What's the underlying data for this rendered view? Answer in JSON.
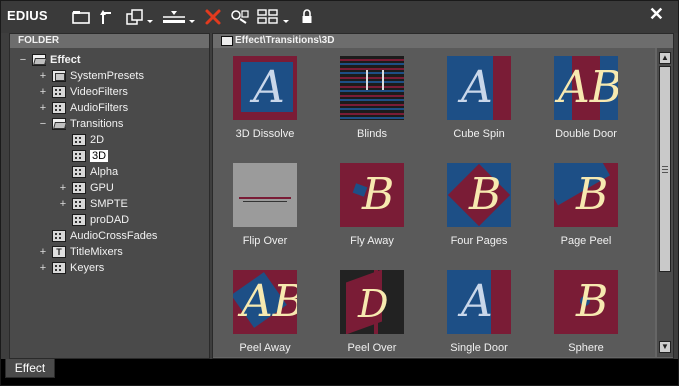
{
  "app": {
    "title": "EDIUS",
    "close_symbol": "✕"
  },
  "toolbar": {
    "icons": [
      "folder-icon",
      "up-level-icon",
      "copy-dropdown-icon",
      "insert-dropdown-icon",
      "delete-icon",
      "properties-icon",
      "view-mode-dropdown-icon",
      "lock-icon"
    ],
    "delete_color": "#e23a1e"
  },
  "left_panel": {
    "header": "FOLDER",
    "tree": [
      {
        "label": "Effect",
        "expander": "−",
        "icon": "folder-open-icon",
        "depth": 0,
        "bold": true
      },
      {
        "label": "SystemPresets",
        "expander": "+",
        "icon": "folder-icon",
        "depth": 1
      },
      {
        "label": "VideoFilters",
        "expander": "+",
        "icon": "grid-icon",
        "depth": 1
      },
      {
        "label": "AudioFilters",
        "expander": "+",
        "icon": "grid-icon",
        "depth": 1
      },
      {
        "label": "Transitions",
        "expander": "−",
        "icon": "folder-open-icon",
        "depth": 1
      },
      {
        "label": "2D",
        "expander": "",
        "icon": "grid-icon",
        "depth": 2
      },
      {
        "label": "3D",
        "expander": "",
        "icon": "grid-icon",
        "depth": 2,
        "selected": true
      },
      {
        "label": "Alpha",
        "expander": "",
        "icon": "grid-icon",
        "depth": 2
      },
      {
        "label": "GPU",
        "expander": "+",
        "icon": "grid-icon",
        "depth": 2
      },
      {
        "label": "SMPTE",
        "expander": "+",
        "icon": "grid-icon",
        "depth": 2
      },
      {
        "label": "proDAD",
        "expander": "",
        "icon": "grid-icon",
        "depth": 2
      },
      {
        "label": "AudioCrossFades",
        "expander": "",
        "icon": "grid-icon",
        "depth": 1
      },
      {
        "label": "TitleMixers",
        "expander": "+",
        "icon": "title-icon",
        "depth": 1
      },
      {
        "label": "Keyers",
        "expander": "+",
        "icon": "grid-icon",
        "depth": 1
      }
    ]
  },
  "right_panel": {
    "path": "Effect\\Transitions\\3D",
    "effects": [
      {
        "label": "3D Dissolve",
        "glyph": "A",
        "style": "dissolve"
      },
      {
        "label": "Blinds",
        "glyph": "",
        "style": "blinds"
      },
      {
        "label": "Cube Spin",
        "glyph": "A",
        "style": "cube"
      },
      {
        "label": "Double Door",
        "glyph": "AB",
        "style": "doubledoor"
      },
      {
        "label": "Flip Over",
        "glyph": "",
        "style": "flip"
      },
      {
        "label": "Fly Away",
        "glyph": "B",
        "style": "flyaway"
      },
      {
        "label": "Four Pages",
        "glyph": "B",
        "style": "fourpages"
      },
      {
        "label": "Page Peel",
        "glyph": "B",
        "style": "pagepeel"
      },
      {
        "label": "Peel Away",
        "glyph": "AB",
        "style": "peelaway"
      },
      {
        "label": "Peel Over",
        "glyph": "D",
        "style": "peelover"
      },
      {
        "label": "Single Door",
        "glyph": "A",
        "style": "singledoor"
      },
      {
        "label": "Sphere",
        "glyph": "B",
        "style": "sphere"
      }
    ]
  },
  "bottom_tabs": [
    {
      "label": "Effect",
      "active": true
    }
  ],
  "colors": {
    "accent_blue": "#1d4f86",
    "accent_red": "#7a1c36",
    "letter": "#f7e9b0"
  }
}
